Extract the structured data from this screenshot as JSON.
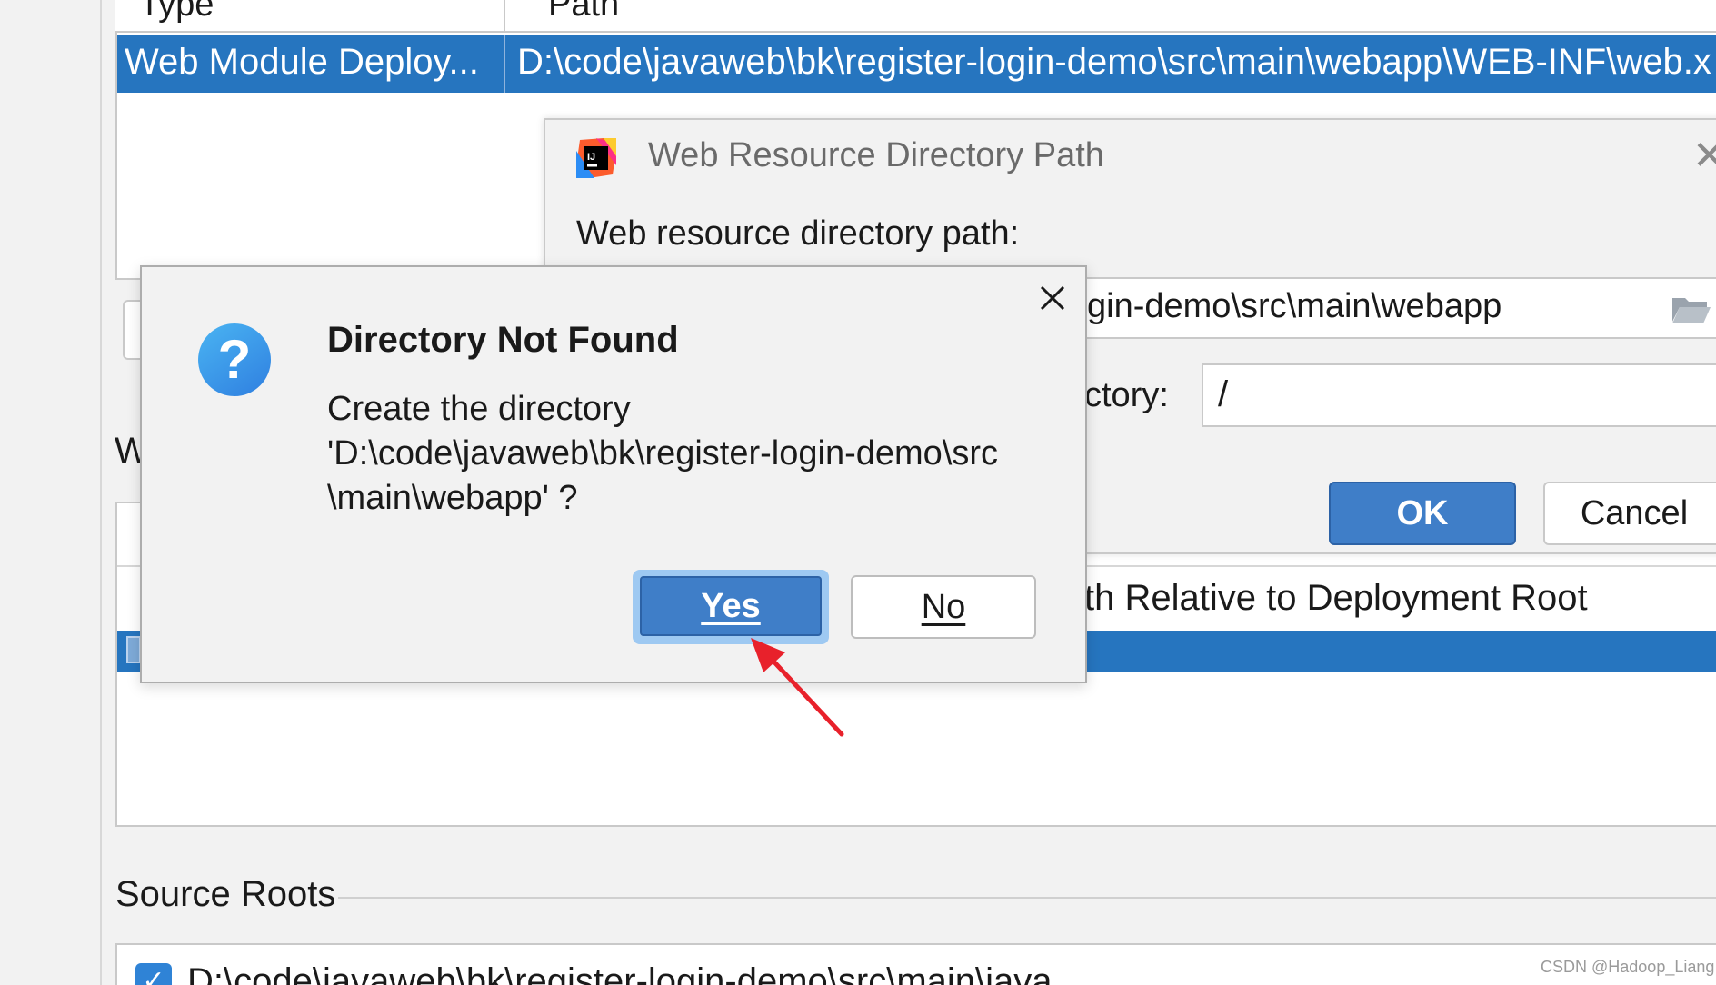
{
  "descriptor_table": {
    "columns": [
      "Type",
      "Path"
    ],
    "selected_row": {
      "type": "Web Module Deploy...",
      "path": "D:\\code\\javaweb\\bk\\register-login-demo\\src\\main\\webapp\\WEB-INF\\web.x"
    }
  },
  "fragments": {
    "w_letter": "W"
  },
  "resource_table": {
    "partial_column_header": "th Relative to Deployment Root"
  },
  "source_roots": {
    "title": "Source Roots",
    "item": "D:\\code\\javaweb\\bk\\register-login-demo\\src\\main\\java",
    "checked": true
  },
  "web_resource_dialog": {
    "title": "Web Resource Directory Path",
    "path_label": "Web resource directory path:",
    "path_value_visible": "gin-demo\\src\\main\\webapp",
    "relative_label_visible": "ctory:",
    "relative_value": "/",
    "ok_label": "OK",
    "cancel_label": "Cancel",
    "logo_text": "IJ"
  },
  "dnf_dialog": {
    "title": "Directory Not Found",
    "message_lines": [
      "Create the directory",
      "'D:\\code\\javaweb\\bk\\register-login-demo\\src",
      "\\main\\webapp' ?"
    ],
    "yes_label": "Yes",
    "no_label": "No",
    "icon_glyph": "?"
  },
  "watermark": "CSDN @Hadoop_Liang",
  "colors": {
    "accent_blue": "#2675bf",
    "button_blue": "#3f7ec8",
    "arrow_red": "#e8212b"
  }
}
